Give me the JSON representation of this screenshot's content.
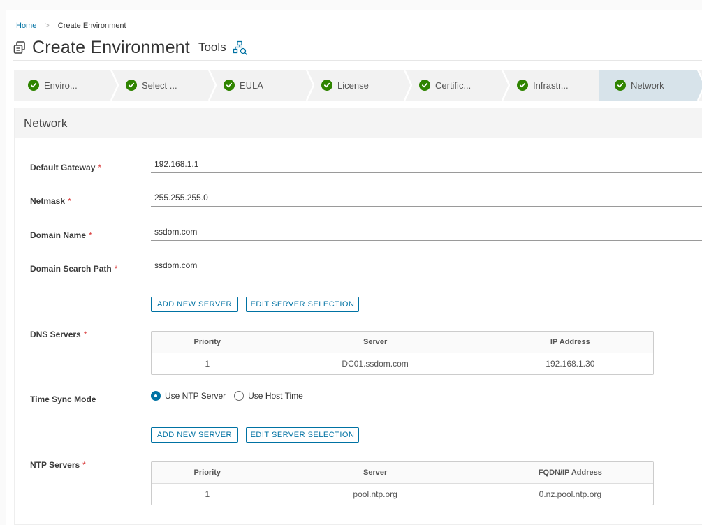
{
  "breadcrumb": {
    "home": "Home",
    "separator": ">",
    "current": "Create Environment"
  },
  "header": {
    "title": "Create Environment",
    "tools_label": "Tools"
  },
  "wizard": {
    "steps": [
      {
        "label": "Enviro...",
        "status": "complete"
      },
      {
        "label": "Select ...",
        "status": "complete"
      },
      {
        "label": "EULA",
        "status": "complete"
      },
      {
        "label": "License",
        "status": "complete"
      },
      {
        "label": "Certific...",
        "status": "complete"
      },
      {
        "label": "Infrastr...",
        "status": "complete"
      },
      {
        "label": "Network",
        "status": "complete",
        "active": true
      }
    ]
  },
  "network": {
    "section_title": "Network",
    "required_marker": "*",
    "default_gateway": {
      "label": "Default Gateway",
      "value": "192.168.1.1"
    },
    "netmask": {
      "label": "Netmask",
      "value": "255.255.255.0"
    },
    "domain_name": {
      "label": "Domain Name",
      "value": "ssdom.com"
    },
    "domain_search_path": {
      "label": "Domain Search Path",
      "value": "ssdom.com"
    },
    "dns": {
      "label": "DNS Servers",
      "add_button": "ADD NEW SERVER",
      "edit_button": "EDIT SERVER SELECTION",
      "columns": [
        "Priority",
        "Server",
        "IP Address"
      ],
      "rows": [
        [
          "1",
          "DC01.ssdom.com",
          "192.168.1.30"
        ]
      ]
    },
    "time_sync": {
      "label": "Time Sync Mode",
      "options": [
        "Use NTP Server",
        "Use Host Time"
      ],
      "selected": "Use NTP Server"
    },
    "ntp": {
      "label": "NTP Servers",
      "add_button": "ADD NEW SERVER",
      "edit_button": "EDIT SERVER SELECTION",
      "columns": [
        "Priority",
        "Server",
        "FQDN/IP Address"
      ],
      "rows": [
        [
          "1",
          "pool.ntp.org",
          "0.nz.pool.ntp.org"
        ]
      ]
    }
  },
  "colors": {
    "accent": "#0072a3",
    "success": "#2f8400",
    "required": "#d93a3a",
    "active_step": "#d7e3ea"
  }
}
